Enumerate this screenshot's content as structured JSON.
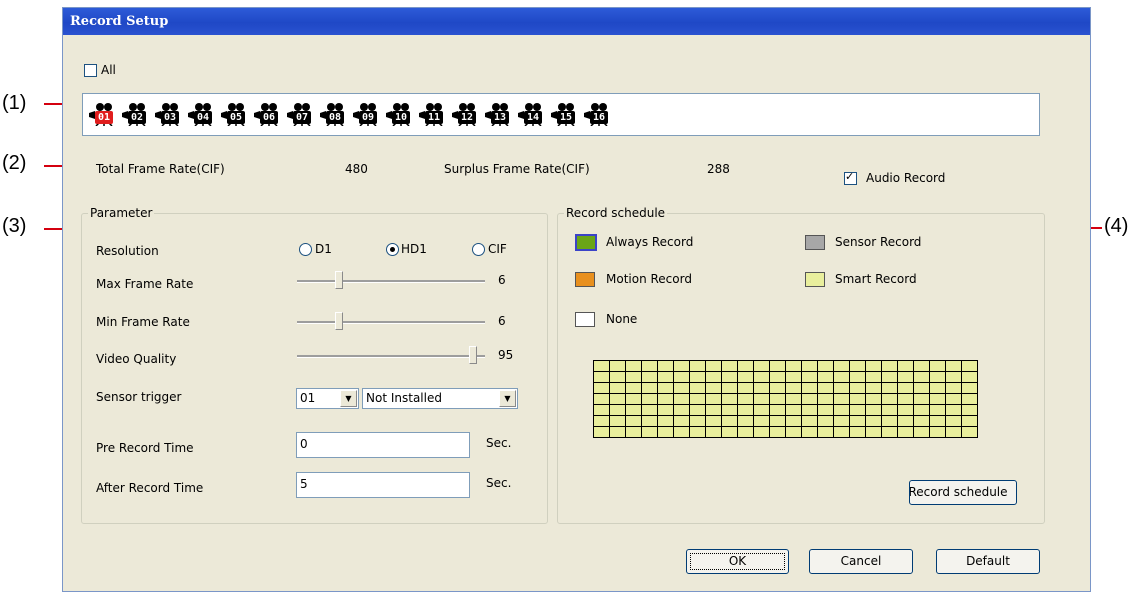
{
  "callouts": [
    "(1)",
    "(2)",
    "(3)",
    "(4)"
  ],
  "dialog": {
    "title": "Record Setup"
  },
  "all_checkbox": {
    "label": "All",
    "checked": false
  },
  "cameras": [
    "01",
    "02",
    "03",
    "04",
    "05",
    "06",
    "07",
    "08",
    "09",
    "10",
    "11",
    "12",
    "13",
    "14",
    "15",
    "16"
  ],
  "active_camera": "01",
  "frame_rates": {
    "total_label": "Total Frame Rate(CIF)",
    "total_value": "480",
    "surplus_label": "Surplus Frame Rate(CIF)",
    "surplus_value": "288"
  },
  "audio_record": {
    "label": "Audio Record",
    "checked": true
  },
  "parameter": {
    "legend": "Parameter",
    "resolution_label": "Resolution",
    "resolution_options": [
      "D1",
      "HD1",
      "CIF"
    ],
    "resolution_selected": "HD1",
    "max_frame_rate_label": "Max Frame Rate",
    "max_frame_rate_value": "6",
    "min_frame_rate_label": "Min Frame Rate",
    "min_frame_rate_value": "6",
    "video_quality_label": "Video Quality",
    "video_quality_value": "95",
    "sensor_trigger_label": "Sensor trigger",
    "sensor_trigger_channel": "01",
    "sensor_trigger_status": "Not Installed",
    "pre_record_label": "Pre Record Time",
    "pre_record_value": "0",
    "after_record_label": "After Record Time",
    "after_record_value": "5",
    "unit": "Sec."
  },
  "schedule": {
    "legend": "Record schedule",
    "legend_items": [
      {
        "label": "Always Record",
        "color": "#6aa516"
      },
      {
        "label": "Sensor Record",
        "color": "#a7a7a7"
      },
      {
        "label": "Motion Record",
        "color": "#e8901e"
      },
      {
        "label": "Smart Record",
        "color": "#e9ef9d"
      },
      {
        "label": "None",
        "color": "#ffffff"
      }
    ],
    "grid_cell_color": "#e9ef9d",
    "button_label": "Record schedule"
  },
  "buttons": {
    "ok": "OK",
    "cancel": "Cancel",
    "default": "Default"
  }
}
